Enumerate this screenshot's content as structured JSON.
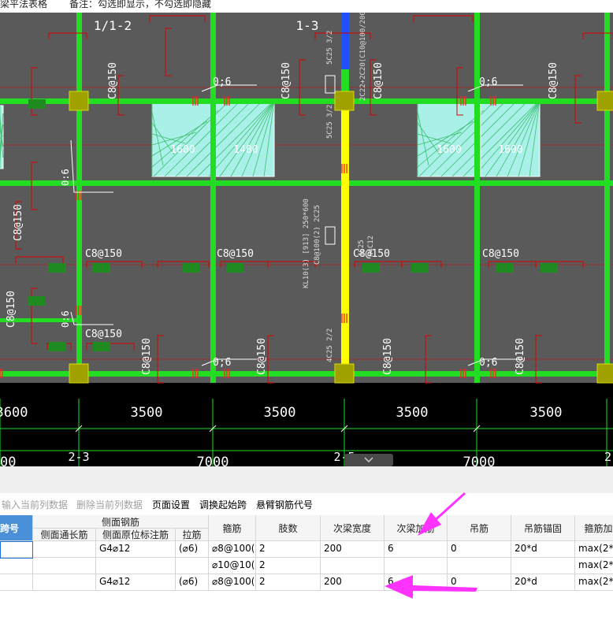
{
  "topbar": {
    "left_text": "梁平法表格",
    "note": "备注：勾选即显示，不勾选即隐藏"
  },
  "cad": {
    "axis_labels": [
      "1/1-2",
      "1-3"
    ],
    "bottom_dims": [
      "3600",
      "3500",
      "3500",
      "3500",
      "3500"
    ],
    "bottom_dims2": [
      "7000",
      "7000"
    ],
    "axis_bottom": [
      "2-3",
      "2-5",
      "2-"
    ],
    "left_partial": "00",
    "stirrup": "C8@150",
    "slab_value": "1600",
    "slab_values": [
      "1600",
      "1400",
      "1600",
      "1600"
    ],
    "rebar_label": "0;6",
    "side_marks": [
      "0:6",
      "0:6"
    ],
    "beam_vertical": "5C25 3/2",
    "beam_vertical2": "2C22+2C20(C10@100/200) 250*400",
    "beam_vertical3": "4C25 2/2",
    "beam_kl": "KL10(3) [913] 250*600",
    "beam_kl2": "C8@100(2) 2C25",
    "beam_kl3": "N4C12",
    "beam_kl4": "4C25",
    "tag_count": 12
  },
  "toolbar": {
    "input_current": "输入当前列数据",
    "delete_current": "删除当前列数据",
    "page_setup": "页面设置",
    "adjust_start": "调换起始跨",
    "cantilever": "悬臂钢筋代号"
  },
  "grid": {
    "headers": {
      "span": "跨号",
      "side_rebar": "侧面钢筋",
      "side_through": "侧面通长筋",
      "side_orig": "侧面原位标注筋",
      "tie": "拉筋",
      "stirrup": "箍筋",
      "legs": "肢数",
      "sec_width": "次梁宽度",
      "sec_add": "次梁加筋",
      "hanger": "吊筋",
      "hanger_anchor": "吊筋锚固",
      "stirrup_add": "箍筋加"
    },
    "rows": [
      {
        "side_orig": "G4⌀12",
        "tie": "(⌀6)",
        "stirrup": "⌀8@100(",
        "legs": "2",
        "sec_width": "200",
        "sec_add": "6",
        "hanger": "0",
        "hanger_anchor": "20*d",
        "stirrup_add": "max(2*h"
      },
      {
        "side_orig": "",
        "tie": "",
        "stirrup": "⌀10@10(",
        "legs": "2",
        "sec_width": "",
        "sec_add": "",
        "hanger": "",
        "hanger_anchor": "",
        "stirrup_add": "max(2*h"
      },
      {
        "side_orig": "G4⌀12",
        "tie": "(⌀6)",
        "stirrup": "⌀8@100(",
        "legs": "2",
        "sec_width": "200",
        "sec_add": "6",
        "hanger": "0",
        "hanger_anchor": "20*d",
        "stirrup_add": "max(2*h"
      }
    ]
  },
  "colors": {
    "cad_bg": "#5a5a5a",
    "beam_green": "#22dd22",
    "selected_beam": "#ffff00",
    "column": "#a0a000",
    "slab": "#a8f0e8",
    "annotation_red": "#dd0000",
    "arrow": "#ff33ff",
    "header_blue": "#4a90d9"
  }
}
